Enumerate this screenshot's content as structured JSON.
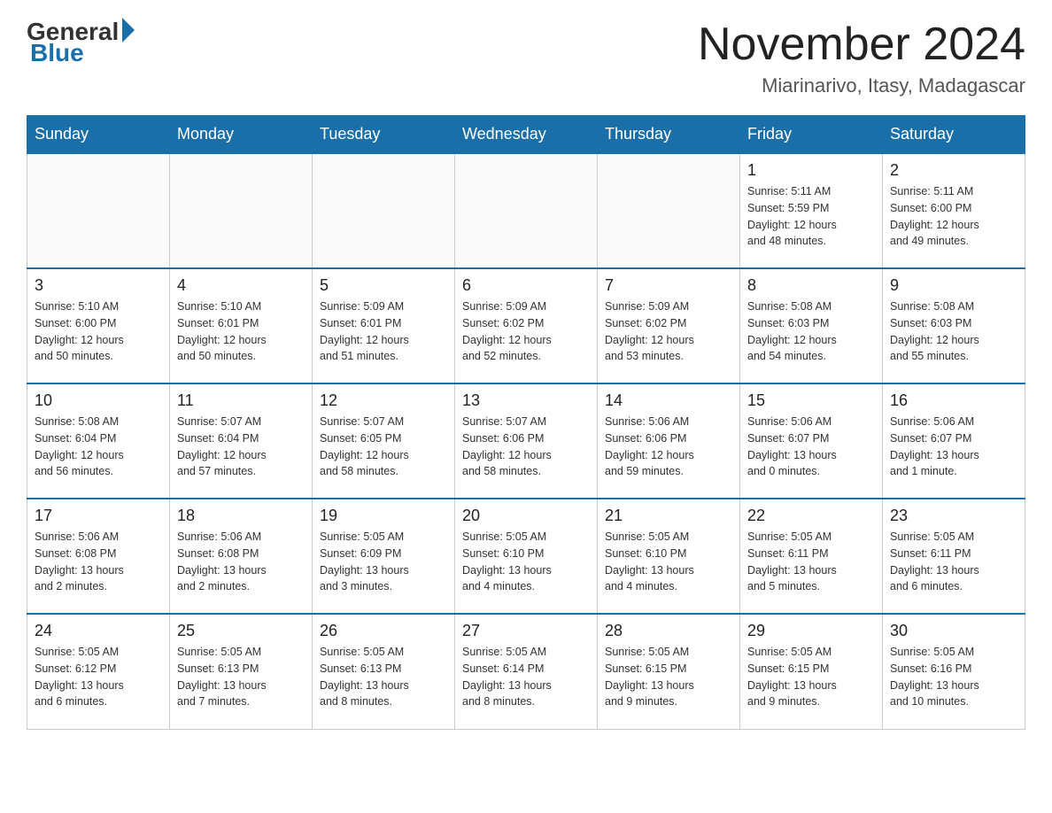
{
  "header": {
    "logo_general": "General",
    "logo_blue": "Blue",
    "month_title": "November 2024",
    "location": "Miarinarivo, Itasy, Madagascar"
  },
  "weekdays": [
    "Sunday",
    "Monday",
    "Tuesday",
    "Wednesday",
    "Thursday",
    "Friday",
    "Saturday"
  ],
  "weeks": [
    [
      {
        "day": "",
        "info": ""
      },
      {
        "day": "",
        "info": ""
      },
      {
        "day": "",
        "info": ""
      },
      {
        "day": "",
        "info": ""
      },
      {
        "day": "",
        "info": ""
      },
      {
        "day": "1",
        "info": "Sunrise: 5:11 AM\nSunset: 5:59 PM\nDaylight: 12 hours\nand 48 minutes."
      },
      {
        "day": "2",
        "info": "Sunrise: 5:11 AM\nSunset: 6:00 PM\nDaylight: 12 hours\nand 49 minutes."
      }
    ],
    [
      {
        "day": "3",
        "info": "Sunrise: 5:10 AM\nSunset: 6:00 PM\nDaylight: 12 hours\nand 50 minutes."
      },
      {
        "day": "4",
        "info": "Sunrise: 5:10 AM\nSunset: 6:01 PM\nDaylight: 12 hours\nand 50 minutes."
      },
      {
        "day": "5",
        "info": "Sunrise: 5:09 AM\nSunset: 6:01 PM\nDaylight: 12 hours\nand 51 minutes."
      },
      {
        "day": "6",
        "info": "Sunrise: 5:09 AM\nSunset: 6:02 PM\nDaylight: 12 hours\nand 52 minutes."
      },
      {
        "day": "7",
        "info": "Sunrise: 5:09 AM\nSunset: 6:02 PM\nDaylight: 12 hours\nand 53 minutes."
      },
      {
        "day": "8",
        "info": "Sunrise: 5:08 AM\nSunset: 6:03 PM\nDaylight: 12 hours\nand 54 minutes."
      },
      {
        "day": "9",
        "info": "Sunrise: 5:08 AM\nSunset: 6:03 PM\nDaylight: 12 hours\nand 55 minutes."
      }
    ],
    [
      {
        "day": "10",
        "info": "Sunrise: 5:08 AM\nSunset: 6:04 PM\nDaylight: 12 hours\nand 56 minutes."
      },
      {
        "day": "11",
        "info": "Sunrise: 5:07 AM\nSunset: 6:04 PM\nDaylight: 12 hours\nand 57 minutes."
      },
      {
        "day": "12",
        "info": "Sunrise: 5:07 AM\nSunset: 6:05 PM\nDaylight: 12 hours\nand 58 minutes."
      },
      {
        "day": "13",
        "info": "Sunrise: 5:07 AM\nSunset: 6:06 PM\nDaylight: 12 hours\nand 58 minutes."
      },
      {
        "day": "14",
        "info": "Sunrise: 5:06 AM\nSunset: 6:06 PM\nDaylight: 12 hours\nand 59 minutes."
      },
      {
        "day": "15",
        "info": "Sunrise: 5:06 AM\nSunset: 6:07 PM\nDaylight: 13 hours\nand 0 minutes."
      },
      {
        "day": "16",
        "info": "Sunrise: 5:06 AM\nSunset: 6:07 PM\nDaylight: 13 hours\nand 1 minute."
      }
    ],
    [
      {
        "day": "17",
        "info": "Sunrise: 5:06 AM\nSunset: 6:08 PM\nDaylight: 13 hours\nand 2 minutes."
      },
      {
        "day": "18",
        "info": "Sunrise: 5:06 AM\nSunset: 6:08 PM\nDaylight: 13 hours\nand 2 minutes."
      },
      {
        "day": "19",
        "info": "Sunrise: 5:05 AM\nSunset: 6:09 PM\nDaylight: 13 hours\nand 3 minutes."
      },
      {
        "day": "20",
        "info": "Sunrise: 5:05 AM\nSunset: 6:10 PM\nDaylight: 13 hours\nand 4 minutes."
      },
      {
        "day": "21",
        "info": "Sunrise: 5:05 AM\nSunset: 6:10 PM\nDaylight: 13 hours\nand 4 minutes."
      },
      {
        "day": "22",
        "info": "Sunrise: 5:05 AM\nSunset: 6:11 PM\nDaylight: 13 hours\nand 5 minutes."
      },
      {
        "day": "23",
        "info": "Sunrise: 5:05 AM\nSunset: 6:11 PM\nDaylight: 13 hours\nand 6 minutes."
      }
    ],
    [
      {
        "day": "24",
        "info": "Sunrise: 5:05 AM\nSunset: 6:12 PM\nDaylight: 13 hours\nand 6 minutes."
      },
      {
        "day": "25",
        "info": "Sunrise: 5:05 AM\nSunset: 6:13 PM\nDaylight: 13 hours\nand 7 minutes."
      },
      {
        "day": "26",
        "info": "Sunrise: 5:05 AM\nSunset: 6:13 PM\nDaylight: 13 hours\nand 8 minutes."
      },
      {
        "day": "27",
        "info": "Sunrise: 5:05 AM\nSunset: 6:14 PM\nDaylight: 13 hours\nand 8 minutes."
      },
      {
        "day": "28",
        "info": "Sunrise: 5:05 AM\nSunset: 6:15 PM\nDaylight: 13 hours\nand 9 minutes."
      },
      {
        "day": "29",
        "info": "Sunrise: 5:05 AM\nSunset: 6:15 PM\nDaylight: 13 hours\nand 9 minutes."
      },
      {
        "day": "30",
        "info": "Sunrise: 5:05 AM\nSunset: 6:16 PM\nDaylight: 13 hours\nand 10 minutes."
      }
    ]
  ]
}
